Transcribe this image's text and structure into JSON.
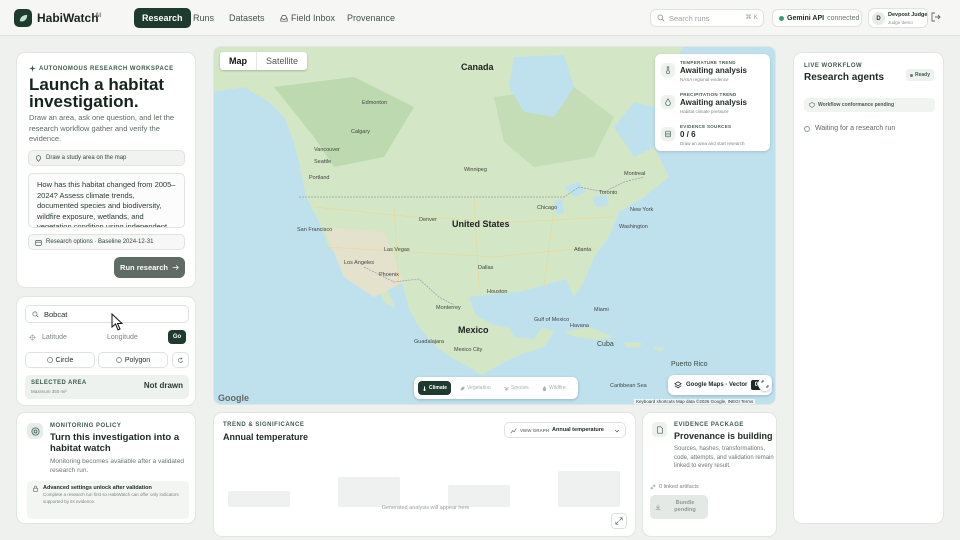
{
  "topbar": {
    "brand": "HabiWatch",
    "brand_badge": "AI",
    "nav": [
      "Research",
      "Runs",
      "Datasets",
      "Field Inbox",
      "Provenance"
    ],
    "search_placeholder": "Search runs",
    "search_shortcut": "⌘ K",
    "api_name": "Gemini API",
    "api_status": "connected",
    "user_initial": "D",
    "user_name": "Devpost Judge",
    "user_role": "Judge demo"
  },
  "launch": {
    "eyebrow": "Autonomous research workspace",
    "title": "Launch a habitat investigation.",
    "description": "Draw an area, ask one question, and let the research workflow gather and verify the evidence.",
    "draw_label": "Draw a study area on the map",
    "question": "How has this habitat changed from 2005–2024? Assess climate trends, documented species and biodiversity, wildfire exposure, wetlands, and vegetation condition using independent authoritative evidence.",
    "options_label": "Research options · Baseline 2024-12-31",
    "run_label": "Run research"
  },
  "area": {
    "search_value": "Bobcat",
    "latitude_placeholder": "Latitude",
    "longitude_placeholder": "Longitude",
    "go_label": "Go",
    "circle_label": "Circle",
    "polygon_label": "Polygon",
    "selected_label": "Selected area",
    "selected_sub": "Maximum 350 mi²",
    "selected_value": "Not drawn"
  },
  "monitor": {
    "eyebrow": "Monitoring policy",
    "title": "Turn this investigation into a habitat watch",
    "description": "Monitoring becomes available after a validated research run.",
    "adv_title": "Advanced settings unlock after validation",
    "adv_desc": "Complete a research run first so HabiWatch can offer only indicators supported by its evidence."
  },
  "map": {
    "tabs": [
      "Map",
      "Satellite"
    ],
    "labels": {
      "canada": "Canada",
      "us": "United States",
      "mexico": "Mexico",
      "cuba": "Cuba",
      "pr": "Puerto Rico",
      "caribbean": "Caribbean Sea",
      "gulf": "Gulf of Mexico"
    },
    "cities": [
      "Edmonton",
      "Calgary",
      "Vancouver",
      "Seattle",
      "Portland",
      "San Francisco",
      "Los Angeles",
      "Las Vegas",
      "Denver",
      "Phoenix",
      "Chicago",
      "Toronto",
      "Montreal",
      "New York",
      "Washington",
      "Atlanta",
      "Dallas",
      "Houston",
      "Miami",
      "Monterrey",
      "Guadalajara",
      "Mexico City",
      "Havana",
      "Winnipeg"
    ],
    "trends": [
      {
        "key": "Temperature trend",
        "value": "Awaiting analysis",
        "sub": "NASA regional evidence"
      },
      {
        "key": "Precipitation trend",
        "value": "Awaiting analysis",
        "sub": "Habitat climate pressure"
      },
      {
        "key": "Evidence sources",
        "value": "0 / 6",
        "sub": "Draw an area and start research"
      }
    ],
    "layers": [
      "Climate",
      "Vegetation",
      "Species",
      "Wildfire"
    ],
    "gmaps_label": "Google Maps · Vector",
    "gmaps_zoom": "0",
    "google_logo": "Google",
    "attribution": "Keyboard shortcuts    Map data ©2026 Google, INEGI    Terms"
  },
  "trend": {
    "eyebrow": "Trend & significance",
    "title": "Annual temperature",
    "graph_key": "View graph",
    "graph_value": "Annual temperature",
    "note": "Generated analysis will appear here"
  },
  "evidence": {
    "eyebrow": "Evidence package",
    "title": "Provenance is building",
    "description": "Sources, hashes, transformations, code, attempts, and validation remain linked to every result.",
    "linked": "0 linked artifacts",
    "bundle": "Bundle pending"
  },
  "agents": {
    "eyebrow": "Live workflow",
    "title": "Research agents",
    "ready": "Ready",
    "conformance": "Workflow conformance pending",
    "waiting": "Waiting for a research run"
  },
  "colors": {
    "brand": "#1f3a2e",
    "accent_green": "#2fa36b",
    "water": "#c8e6f0",
    "land": "#cfe3c4"
  }
}
